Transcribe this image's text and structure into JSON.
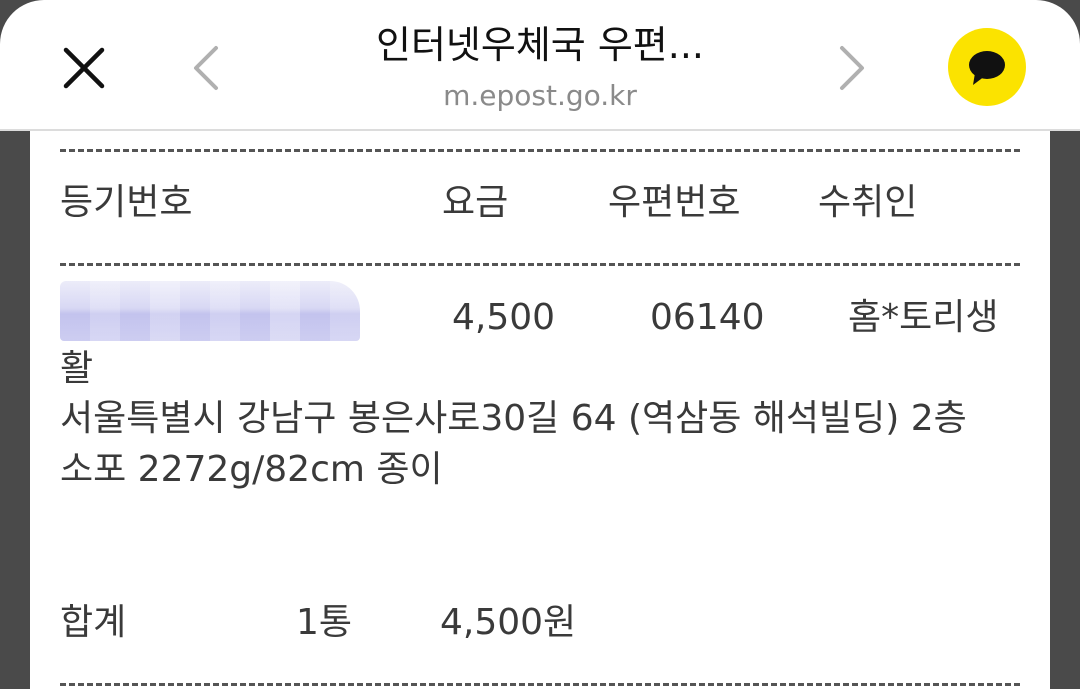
{
  "header": {
    "title": "인터넷우체국 우편...",
    "url": "m.epost.go.kr"
  },
  "icons": {
    "close": "close-icon",
    "back": "chevron-left-icon",
    "forward": "chevron-right-icon",
    "talk": "speech-bubble-icon"
  },
  "colors": {
    "talk_button": "#fbe300",
    "background": "#4a4a4a"
  },
  "table": {
    "headers": {
      "registration_no": "등기번호",
      "fee": "요금",
      "postal_code": "우편번호",
      "recipient": "수취인"
    },
    "row": {
      "fee": "4,500",
      "postal_code": "06140",
      "recipient": "홈*토리생",
      "recipient_cont": "활",
      "address": "서울특별시 강남구 봉은사로30길 64 (역삼동 해석빌딩) 2층",
      "package": "소포 2272g/82cm 종이"
    },
    "summary": {
      "label": "합계",
      "count": "1통",
      "total": "4,500원"
    }
  }
}
